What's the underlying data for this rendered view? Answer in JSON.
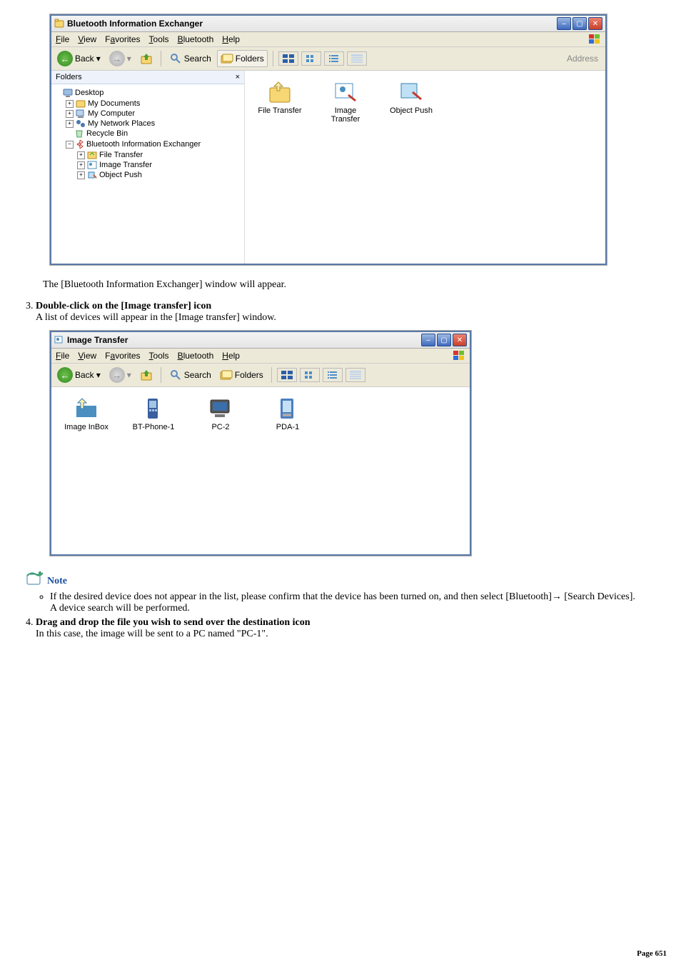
{
  "win1": {
    "title": "Bluetooth Information Exchanger",
    "menu": [
      "File",
      "View",
      "Favorites",
      "Tools",
      "Bluetooth",
      "Help"
    ],
    "toolbar": {
      "back": "Back",
      "search": "Search",
      "folders": "Folders",
      "address": "Address"
    },
    "folders_hdr": "Folders",
    "folders_close": "×",
    "tree": {
      "desktop": "Desktop",
      "mydocs": "My Documents",
      "mycomp": "My Computer",
      "mynet": "My Network Places",
      "recycle": "Recycle Bin",
      "bie": "Bluetooth Information Exchanger",
      "ft": "File Transfer",
      "it": "Image Transfer",
      "op": "Object Push"
    },
    "content": {
      "ft": "File Transfer",
      "it": "Image\nTransfer",
      "op": "Object Push"
    }
  },
  "caption1": "The [Bluetooth Information Exchanger] window will appear.",
  "step3_title": "Double-click on the [Image transfer] icon",
  "step3_body": "A list of devices will appear in the [Image transfer] window.",
  "win2": {
    "title": "Image Transfer",
    "menu": [
      "File",
      "View",
      "Favorites",
      "Tools",
      "Bluetooth",
      "Help"
    ],
    "toolbar": {
      "back": "Back",
      "search": "Search",
      "folders": "Folders"
    },
    "items": {
      "inbox": "Image InBox",
      "bt": "BT-Phone-1",
      "pc": "PC-2",
      "pda": "PDA-1"
    }
  },
  "note_label": "Note",
  "note_body_a": "If the desired device does not appear in the list, please confirm that the device has been turned on, and then select [Bluetooth]→ [Search Devices].",
  "note_body_b": "A device search will be performed.",
  "step4_title": "Drag and drop the file you wish to send over the destination icon",
  "step4_body": "In this case, the image will be sent to a PC named \"PC-1\".",
  "page_footer": "Page  651"
}
